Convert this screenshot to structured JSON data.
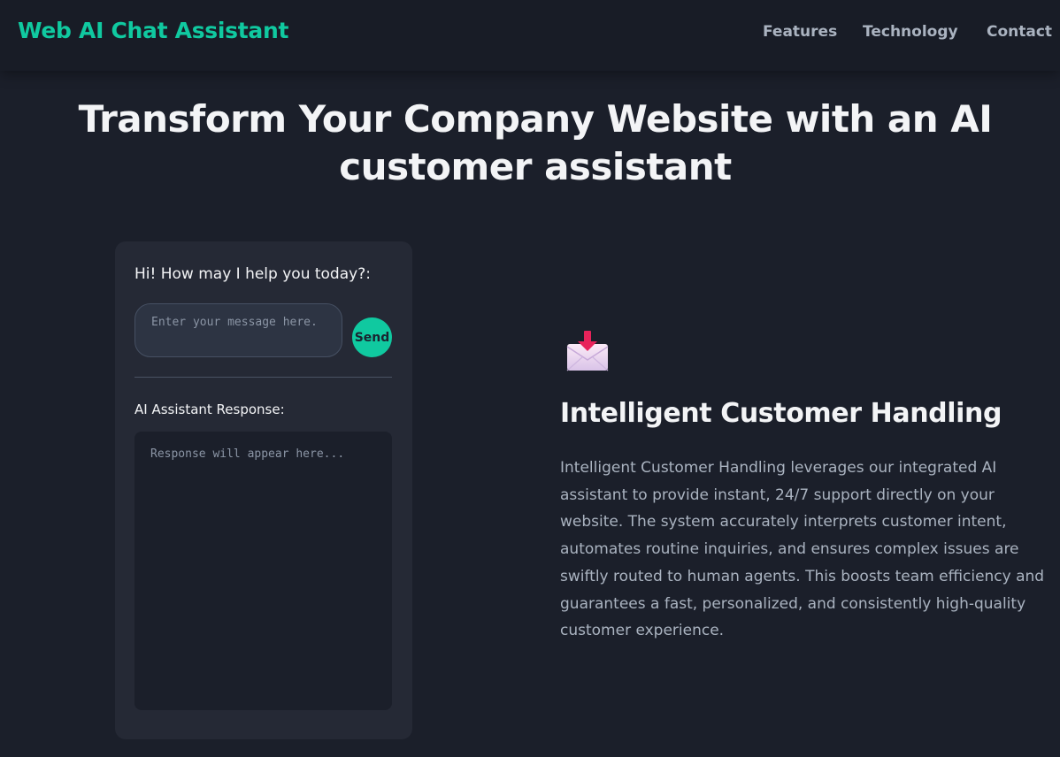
{
  "header": {
    "brand": "Web AI Chat Assistant",
    "nav": [
      {
        "label": "Features"
      },
      {
        "label": "Technology"
      },
      {
        "label": "Contact"
      }
    ]
  },
  "hero": {
    "title": "Transform Your Company Website with an AI customer assistant"
  },
  "chat": {
    "greeting": "Hi! How may I help you today?:",
    "input_placeholder": "Enter your message here.",
    "send_label": "Send",
    "response_label": "AI Assistant Response:",
    "response_placeholder": "Response will appear here..."
  },
  "feature": {
    "icon": "envelope-download-icon",
    "title": "Intelligent Customer Handling",
    "description": "Intelligent Customer Handling leverages our integrated AI assistant to provide instant, 24/7 support directly on your website. The system accurately interprets customer intent, automates routine inquiries, and ensures complex issues are swiftly routed to human agents. This boosts team efficiency and guarantees a fast, personalized, and consistently high-quality customer experience."
  },
  "colors": {
    "background": "#1b1f2a",
    "accent": "#10c9a0",
    "card": "#252935",
    "muted_text": "#aab3c0"
  }
}
